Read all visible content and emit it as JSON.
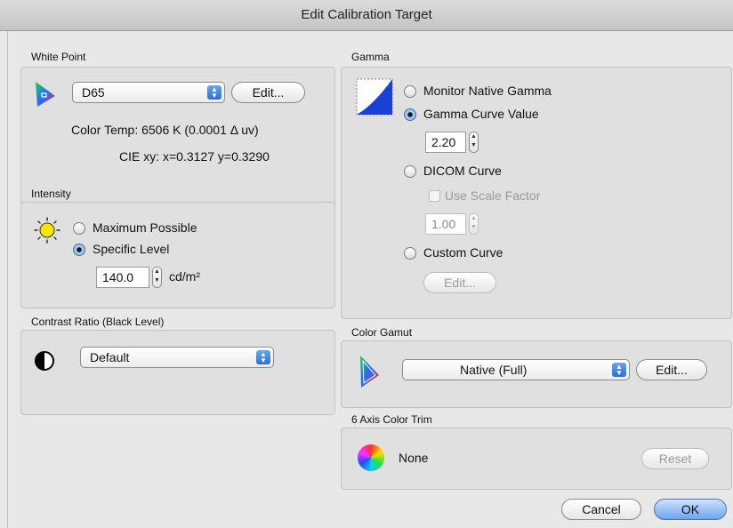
{
  "window": {
    "title": "Edit Calibration Target"
  },
  "white_point": {
    "section_label": "White Point",
    "preset": "D65",
    "edit_label": "Edit...",
    "color_temp": "Color Temp:  6506 K (0.0001 Δ uv)",
    "cie": "CIE xy:  x=0.3127 y=0.3290"
  },
  "intensity": {
    "section_label": "Intensity",
    "option_max": "Maximum Possible",
    "option_specific": "Specific Level",
    "value": "140.0",
    "unit": "cd/m²"
  },
  "contrast": {
    "section_label": "Contrast Ratio (Black Level)",
    "value": "Default"
  },
  "gamma": {
    "section_label": "Gamma",
    "option_native": "Monitor Native Gamma",
    "option_curve_value": "Gamma Curve Value",
    "curve_value": "2.20",
    "option_dicom": "DICOM Curve",
    "use_scale_factor": "Use Scale Factor",
    "scale_value": "1.00",
    "option_custom": "Custom Curve",
    "edit_label": "Edit..."
  },
  "color_gamut": {
    "section_label": "Color Gamut",
    "value": "Native (Full)",
    "edit_label": "Edit..."
  },
  "color_trim": {
    "section_label": "6 Axis Color Trim",
    "value": "None",
    "reset_label": "Reset"
  },
  "footer": {
    "cancel_label": "Cancel",
    "ok_label": "OK"
  },
  "colors": {
    "accent": "#3b78dc",
    "panel": "#e0e0e0"
  }
}
